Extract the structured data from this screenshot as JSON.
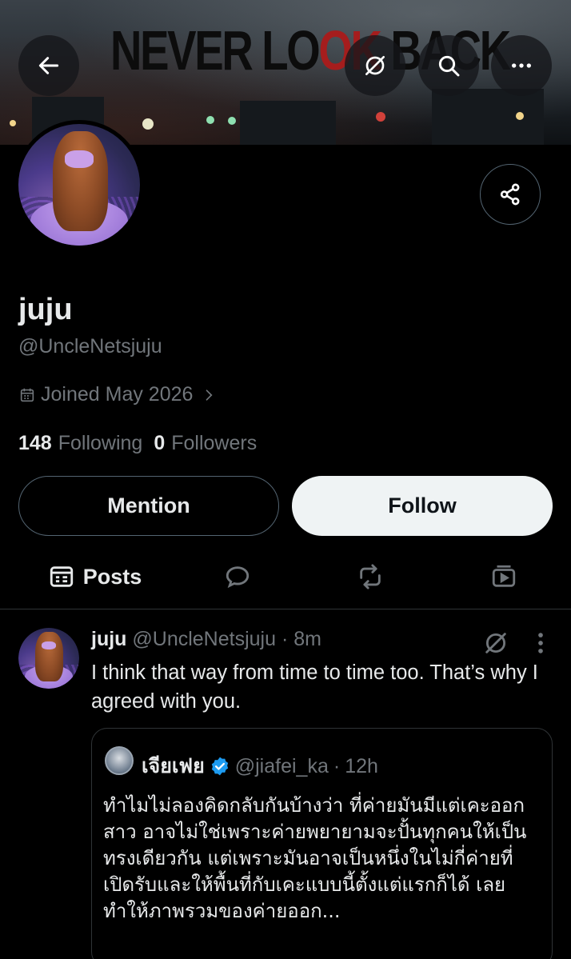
{
  "banner": {
    "text_part1": "NEVER LO",
    "text_ok": "OK",
    "text_part2": " BACK"
  },
  "profile": {
    "display_name": "juju",
    "handle": "@UncleNetsjuju",
    "joined": "Joined May 2026",
    "following_count": "148",
    "following_label": "Following",
    "followers_count": "0",
    "followers_label": "Followers"
  },
  "actions": {
    "mention_label": "Mention",
    "follow_label": "Follow"
  },
  "tabs": [
    {
      "label": "Posts",
      "icon": "posts-icon",
      "selected": true
    },
    {
      "label": "",
      "icon": "replies-icon"
    },
    {
      "label": "",
      "icon": "retweet-icon"
    },
    {
      "label": "",
      "icon": "media-icon"
    }
  ],
  "post": {
    "author_name": "juju",
    "author_handle": "@UncleNetsjuju",
    "time": "8m",
    "text": "I think that way from time to time too. That’s why I agreed with you.",
    "quote": {
      "name": "เจียเฟย",
      "handle": "@jiafei_ka",
      "time": "12h",
      "verified": true,
      "text": "ทำไมไม่ลองคิดกลับกันบ้างว่า ที่ค่ายมันมีแต่เคะออกสาว อาจไม่ใช่เพราะค่ายพยายามจะปั้นทุกคนให้เป็นทรงเดียวกัน แต่เพราะมันอาจเป็นหนึ่งในไม่กี่ค่ายที่เปิดรับและให้พื้นที่กับเคะแบบนี้ตั้งแต่แรกก็ได้ เลยทำให้ภาพรวมของค่ายออก..."
    }
  },
  "colors": {
    "background": "#000000",
    "text": "#e7e9ea",
    "muted": "#71767b",
    "border": "#2f3336",
    "verified": "#1d9bf0"
  }
}
